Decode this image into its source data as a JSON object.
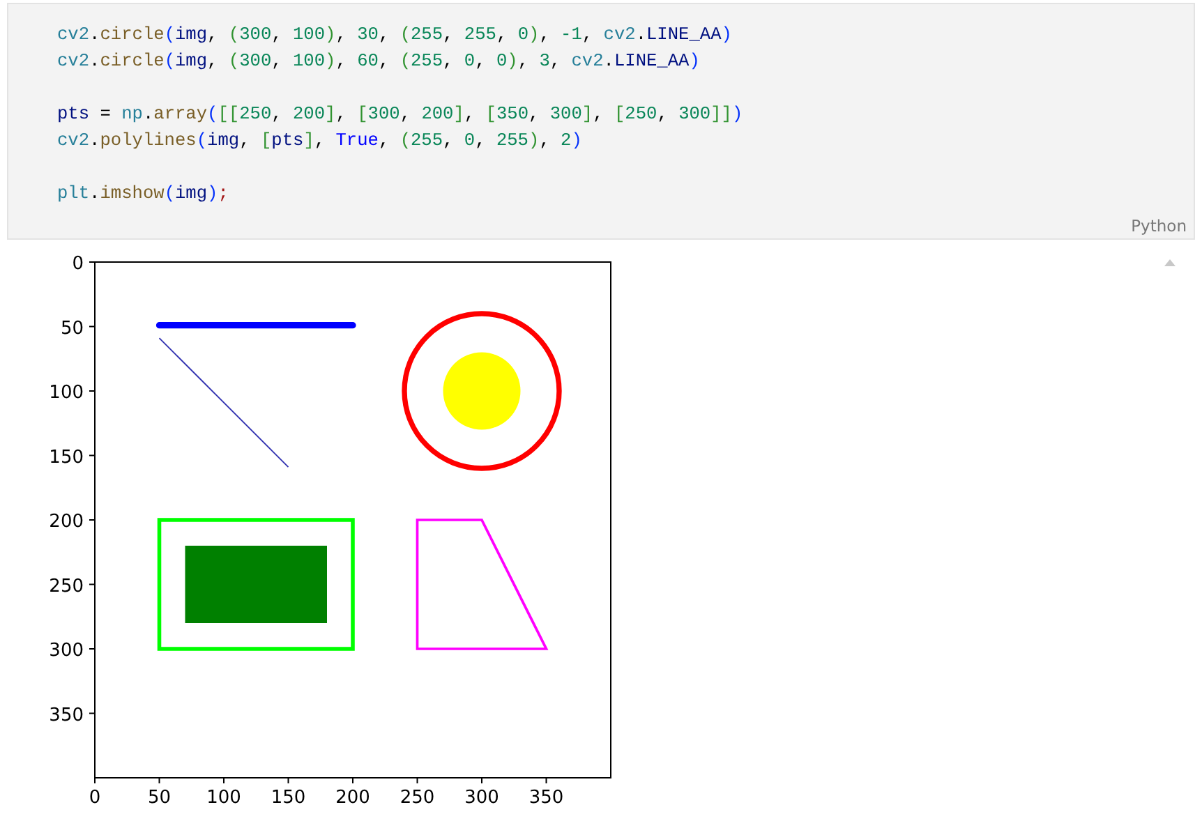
{
  "code_cell": {
    "blocks": [
      [
        [
          {
            "kind": "module",
            "text": "cv2"
          },
          {
            "kind": "plain",
            "text": "."
          },
          {
            "kind": "func",
            "text": "circle"
          },
          {
            "kind": "paren",
            "text": "("
          },
          {
            "kind": "var",
            "text": "img"
          },
          {
            "kind": "plain",
            "text": ", "
          },
          {
            "kind": "paren2",
            "text": "("
          },
          {
            "kind": "num",
            "text": "300"
          },
          {
            "kind": "plain",
            "text": ", "
          },
          {
            "kind": "num",
            "text": "100"
          },
          {
            "kind": "paren2",
            "text": ")"
          },
          {
            "kind": "plain",
            "text": ", "
          },
          {
            "kind": "num",
            "text": "30"
          },
          {
            "kind": "plain",
            "text": ", "
          },
          {
            "kind": "paren2",
            "text": "("
          },
          {
            "kind": "num",
            "text": "255"
          },
          {
            "kind": "plain",
            "text": ", "
          },
          {
            "kind": "num",
            "text": "255"
          },
          {
            "kind": "plain",
            "text": ", "
          },
          {
            "kind": "num",
            "text": "0"
          },
          {
            "kind": "paren2",
            "text": ")"
          },
          {
            "kind": "plain",
            "text": ", "
          },
          {
            "kind": "num",
            "text": "-1"
          },
          {
            "kind": "plain",
            "text": ", "
          },
          {
            "kind": "module",
            "text": "cv2"
          },
          {
            "kind": "plain",
            "text": "."
          },
          {
            "kind": "var",
            "text": "LINE_AA"
          },
          {
            "kind": "paren",
            "text": ")"
          }
        ],
        [
          {
            "kind": "module",
            "text": "cv2"
          },
          {
            "kind": "plain",
            "text": "."
          },
          {
            "kind": "func",
            "text": "circle"
          },
          {
            "kind": "paren",
            "text": "("
          },
          {
            "kind": "var",
            "text": "img"
          },
          {
            "kind": "plain",
            "text": ", "
          },
          {
            "kind": "paren2",
            "text": "("
          },
          {
            "kind": "num",
            "text": "300"
          },
          {
            "kind": "plain",
            "text": ", "
          },
          {
            "kind": "num",
            "text": "100"
          },
          {
            "kind": "paren2",
            "text": ")"
          },
          {
            "kind": "plain",
            "text": ", "
          },
          {
            "kind": "num",
            "text": "60"
          },
          {
            "kind": "plain",
            "text": ", "
          },
          {
            "kind": "paren2",
            "text": "("
          },
          {
            "kind": "num",
            "text": "255"
          },
          {
            "kind": "plain",
            "text": ", "
          },
          {
            "kind": "num",
            "text": "0"
          },
          {
            "kind": "plain",
            "text": ", "
          },
          {
            "kind": "num",
            "text": "0"
          },
          {
            "kind": "paren2",
            "text": ")"
          },
          {
            "kind": "plain",
            "text": ", "
          },
          {
            "kind": "num",
            "text": "3"
          },
          {
            "kind": "plain",
            "text": ", "
          },
          {
            "kind": "module",
            "text": "cv2"
          },
          {
            "kind": "plain",
            "text": "."
          },
          {
            "kind": "var",
            "text": "LINE_AA"
          },
          {
            "kind": "paren",
            "text": ")"
          }
        ]
      ],
      [
        [
          {
            "kind": "var",
            "text": "pts"
          },
          {
            "kind": "plain",
            "text": " = "
          },
          {
            "kind": "module",
            "text": "np"
          },
          {
            "kind": "plain",
            "text": "."
          },
          {
            "kind": "func",
            "text": "array"
          },
          {
            "kind": "paren",
            "text": "("
          },
          {
            "kind": "paren2",
            "text": "[["
          },
          {
            "kind": "num",
            "text": "250"
          },
          {
            "kind": "plain",
            "text": ", "
          },
          {
            "kind": "num",
            "text": "200"
          },
          {
            "kind": "paren2",
            "text": "]"
          },
          {
            "kind": "plain",
            "text": ", "
          },
          {
            "kind": "paren2",
            "text": "["
          },
          {
            "kind": "num",
            "text": "300"
          },
          {
            "kind": "plain",
            "text": ", "
          },
          {
            "kind": "num",
            "text": "200"
          },
          {
            "kind": "paren2",
            "text": "]"
          },
          {
            "kind": "plain",
            "text": ", "
          },
          {
            "kind": "paren2",
            "text": "["
          },
          {
            "kind": "num",
            "text": "350"
          },
          {
            "kind": "plain",
            "text": ", "
          },
          {
            "kind": "num",
            "text": "300"
          },
          {
            "kind": "paren2",
            "text": "]"
          },
          {
            "kind": "plain",
            "text": ", "
          },
          {
            "kind": "paren2",
            "text": "["
          },
          {
            "kind": "num",
            "text": "250"
          },
          {
            "kind": "plain",
            "text": ", "
          },
          {
            "kind": "num",
            "text": "300"
          },
          {
            "kind": "paren2",
            "text": "]]"
          },
          {
            "kind": "paren",
            "text": ")"
          }
        ],
        [
          {
            "kind": "module",
            "text": "cv2"
          },
          {
            "kind": "plain",
            "text": "."
          },
          {
            "kind": "func",
            "text": "polylines"
          },
          {
            "kind": "paren",
            "text": "("
          },
          {
            "kind": "var",
            "text": "img"
          },
          {
            "kind": "plain",
            "text": ", "
          },
          {
            "kind": "paren2",
            "text": "["
          },
          {
            "kind": "var",
            "text": "pts"
          },
          {
            "kind": "paren2",
            "text": "]"
          },
          {
            "kind": "plain",
            "text": ", "
          },
          {
            "kind": "keyword",
            "text": "True"
          },
          {
            "kind": "plain",
            "text": ", "
          },
          {
            "kind": "paren2",
            "text": "("
          },
          {
            "kind": "num",
            "text": "255"
          },
          {
            "kind": "plain",
            "text": ", "
          },
          {
            "kind": "num",
            "text": "0"
          },
          {
            "kind": "plain",
            "text": ", "
          },
          {
            "kind": "num",
            "text": "255"
          },
          {
            "kind": "paren2",
            "text": ")"
          },
          {
            "kind": "plain",
            "text": ", "
          },
          {
            "kind": "num",
            "text": "2"
          },
          {
            "kind": "paren",
            "text": ")"
          }
        ]
      ],
      [
        [
          {
            "kind": "module",
            "text": "plt"
          },
          {
            "kind": "plain",
            "text": "."
          },
          {
            "kind": "func",
            "text": "imshow"
          },
          {
            "kind": "paren",
            "text": "("
          },
          {
            "kind": "var",
            "text": "img"
          },
          {
            "kind": "paren",
            "text": ")"
          },
          {
            "kind": "semi",
            "text": ";"
          }
        ]
      ]
    ],
    "language": "Python"
  },
  "figure": {
    "xticks": [
      "0",
      "50",
      "100",
      "150",
      "200",
      "250",
      "300",
      "350"
    ],
    "yticks": [
      "0",
      "50",
      "100",
      "150",
      "200",
      "250",
      "300",
      "350"
    ]
  }
}
